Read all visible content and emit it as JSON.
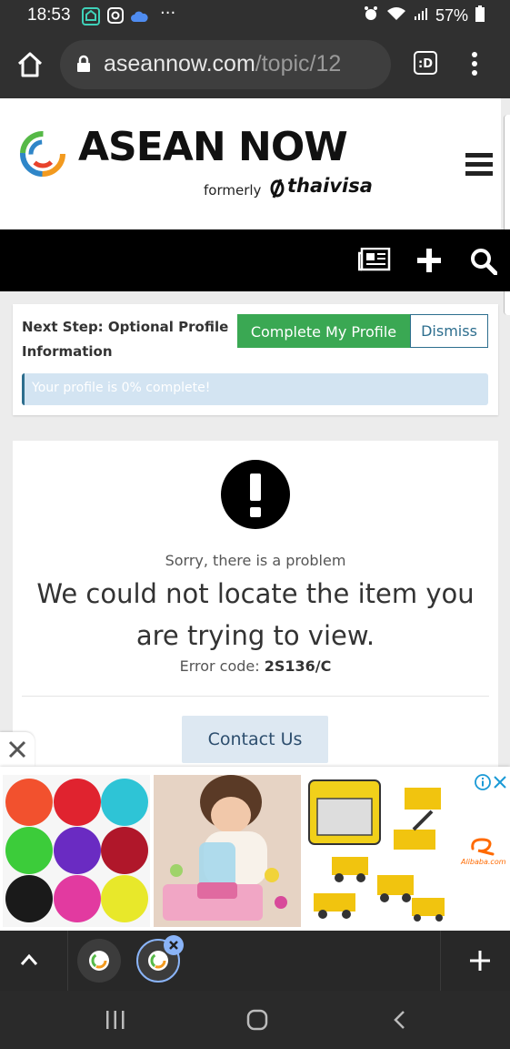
{
  "status_bar": {
    "time": "18:53",
    "battery": "57%"
  },
  "browser": {
    "url_host": "aseannow.com",
    "url_path": "/topic/12",
    "tab_count": ":D"
  },
  "site": {
    "logo_text": "ASEAN NOW",
    "formerly_label": "formerly",
    "formerly_brand": "thaivisa"
  },
  "profile_prompt": {
    "title": "Next Step: Optional Profile Information",
    "complete_label": "Complete My Profile",
    "dismiss_label": "Dismiss",
    "progress_text": "Your profile is 0% complete!",
    "progress_percent": 0
  },
  "error": {
    "sorry": "Sorry, there is a problem",
    "headline": "We could not locate the item you are trying to view.",
    "code_label": "Error code:",
    "code_value": "2S136/C",
    "contact_label": "Contact Us"
  },
  "ad": {
    "advertiser_text": "Alibaba.com"
  },
  "colors": {
    "accent_green": "#3aa853",
    "accent_blue": "#2d6e8e",
    "progress_bg": "#d3e4f2"
  }
}
